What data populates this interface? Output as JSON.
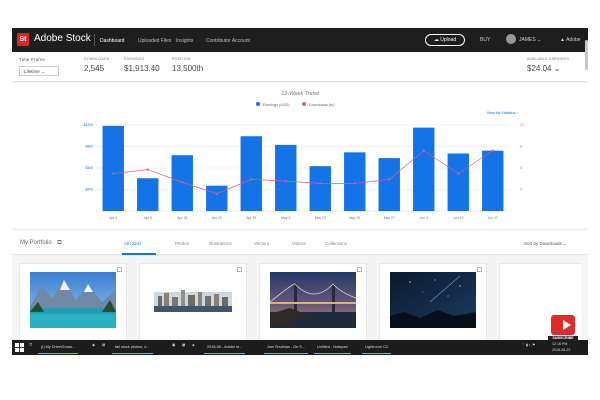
{
  "app": {
    "logo_text": "St",
    "brand": "Adobe Stock"
  },
  "nav": {
    "items": [
      {
        "label": "Dashboard",
        "active": true
      },
      {
        "label": "Uploaded Files",
        "active": false
      },
      {
        "label": "Insights",
        "active": false
      },
      {
        "label": "Contributor Account",
        "active": false
      }
    ],
    "upload_label": "Upload",
    "buy_label": "BUY",
    "user_label": "JAMES ⌄",
    "adobe_label": "Adobe"
  },
  "stats": {
    "timeframe_label": "Time Frame",
    "timeframe_value": "Lifetime ⌄",
    "downloads_label": "DOWNLOADS",
    "downloads_value": "2,545",
    "earnings_label": "EARNINGS",
    "earnings_value": "$1,913.40",
    "position_label": "POSITION",
    "position_value": "13,500th",
    "available_label": "AVAILABLE EARNINGS",
    "available_value": "$24.04 ⌄"
  },
  "chart": {
    "title": "12-Week Trend",
    "legend_earnings": "Earnings (USD)",
    "legend_downloads": "Downloads (to)",
    "link": "View My Statistics ›",
    "colors": {
      "bar": "#1473e6",
      "line": "#e05a83",
      "grid": "#f0d0da"
    }
  },
  "chart_data": {
    "type": "bar",
    "title": "12-Week Trend",
    "categories": [
      "Apr 1",
      "Apr 8",
      "Apr 15",
      "Apr 22",
      "Apr 29",
      "May 6",
      "May 13",
      "May 20",
      "May 27",
      "Jun 3",
      "Jun 10",
      "Jun 17"
    ],
    "series": [
      {
        "name": "Earnings (USD)",
        "type": "bar",
        "axis": "left",
        "values": [
          148,
          57,
          97,
          44,
          130,
          115,
          78,
          102,
          92,
          145,
          100,
          105
        ]
      },
      {
        "name": "Downloads (to)",
        "type": "line",
        "axis": "right",
        "values": [
          6.5,
          7.2,
          5.0,
          3.0,
          5.5,
          5.2,
          4.8,
          4.8,
          5.5,
          10.5,
          6.5,
          10.5
        ]
      }
    ],
    "left_ticks": [
      "$1200",
      "$800",
      "$400",
      "$200"
    ],
    "right_ticks": [
      "12",
      "8",
      "4",
      "0"
    ],
    "ylim_left": [
      0,
      160
    ],
    "ylim_right": [
      0,
      16
    ],
    "legend": "top-center"
  },
  "portfolio": {
    "title": "My Portfolio",
    "tabs": [
      {
        "label": "All (224)",
        "active": true
      },
      {
        "label": "Photos",
        "active": false
      },
      {
        "label": "Illustrations",
        "active": false
      },
      {
        "label": "Vectors",
        "active": false
      },
      {
        "label": "Videos",
        "active": false
      },
      {
        "label": "Collections",
        "active": false
      }
    ],
    "sort_label": "Sort by Downloads ⌄"
  },
  "taskbar": {
    "apps": [
      "(I) My Drive\\Gruas...",
      "fall stock photos, e...",
      "2018-06 - Adobe st...",
      "Joel Shulman - De S...",
      "Untitled - Notepad",
      "Lightroom CC"
    ],
    "time": "12:16 PM",
    "date": "2018-06-22"
  },
  "youtube": {
    "label": "SUBSCRIBE"
  }
}
